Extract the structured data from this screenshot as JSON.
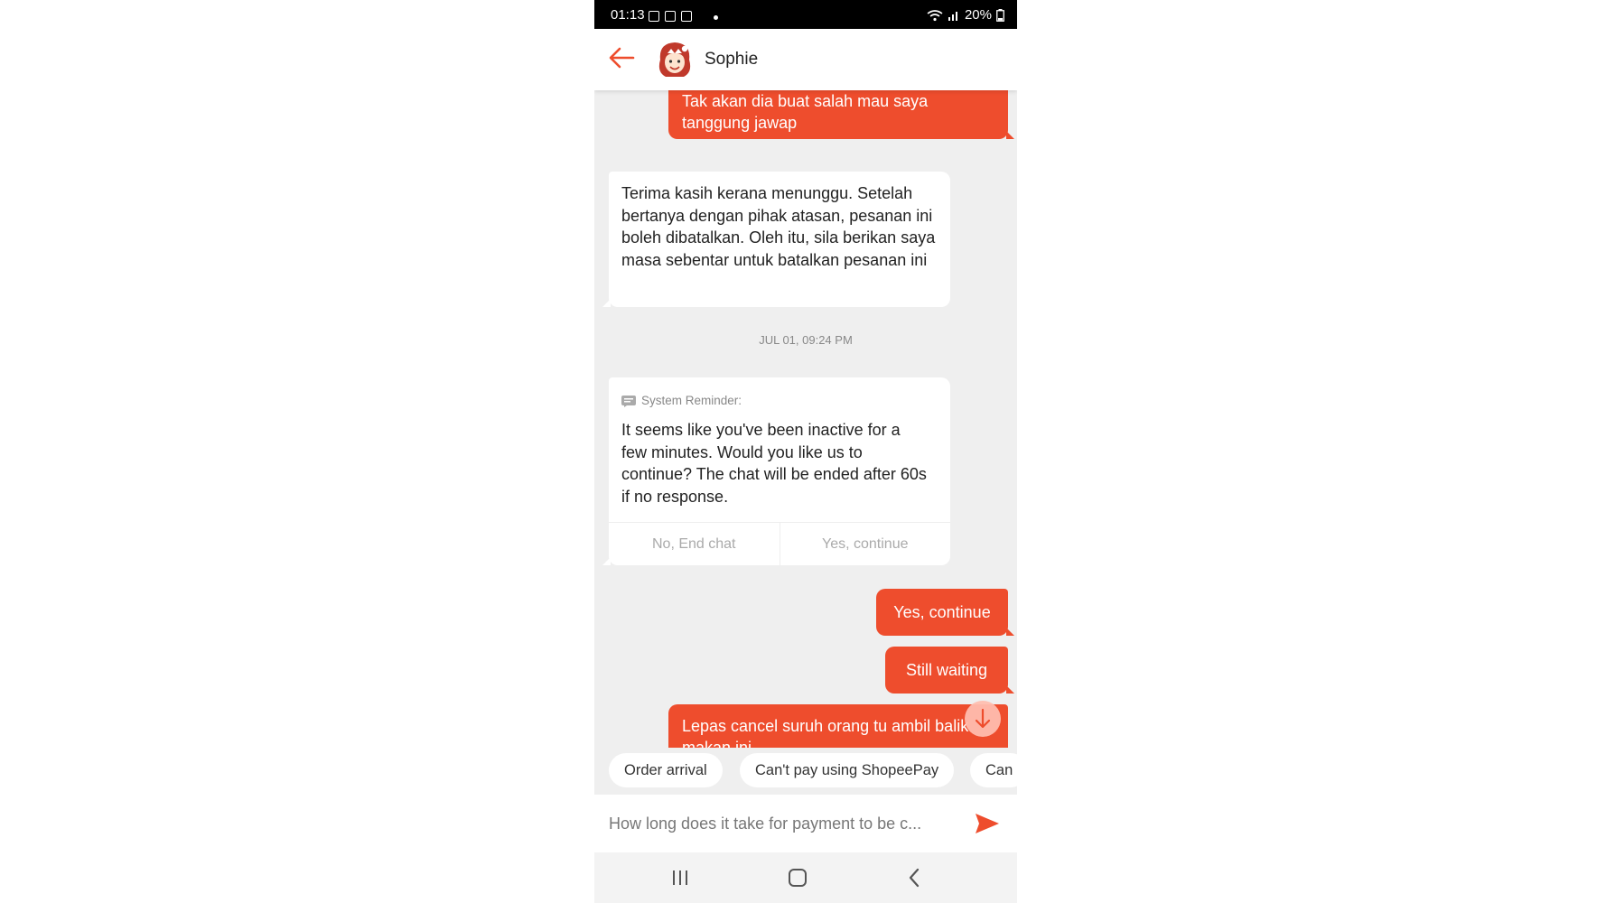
{
  "status_bar": {
    "time": "01:13",
    "battery": "20%"
  },
  "header": {
    "contact_name": "Sophie"
  },
  "messages": {
    "out_1": "Tak akan dia buat salah mau saya tanggung jawap",
    "in_1": "Terima kasih kerana menunggu. Setelah bertanya dengan pihak atasan, pesanan ini boleh dibatalkan. Oleh itu, sila berikan saya masa sebentar untuk batalkan pesanan ini",
    "timestamp": "JUL 01, 09:24 PM",
    "out_2": "Yes, continue",
    "out_3": "Still waiting",
    "out_4": "Lepas cancel suruh orang tu ambil balik makan ini"
  },
  "reminder": {
    "title": "System Reminder:",
    "body": "It seems like you've been inactive for a few minutes. Would you like us to continue? The chat will be ended after 60s if no response.",
    "no_label": "No, End chat",
    "yes_label": "Yes, continue"
  },
  "quick_replies": [
    "Order arrival",
    "Can't pay using ShopeePay",
    "Can"
  ],
  "input": {
    "placeholder": "How long does it take for payment to be c..."
  },
  "colors": {
    "accent": "#ee4d2d",
    "chat_bg": "#efefef"
  },
  "icons": {
    "back": "arrow-left-icon",
    "send": "send-icon",
    "scroll_down": "arrow-down-icon",
    "reminder": "message-icon"
  }
}
